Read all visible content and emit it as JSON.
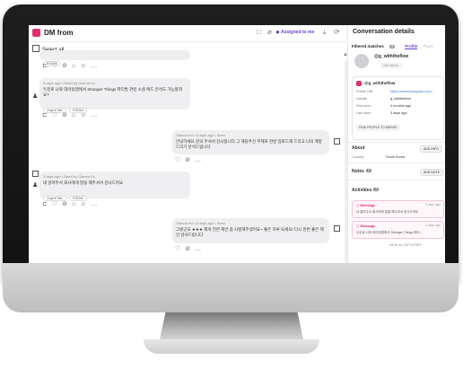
{
  "header": {
    "title": "DM from",
    "assigned_label": "Assigned to me"
  },
  "list": {
    "select_all": "Select all",
    "messages": [
      {
        "meta": "",
        "text": "",
        "tags": [
          "RIS263"
        ]
      },
      {
        "meta": "3 days ago • Read by Gianna Ko",
        "text": "두분로 나와 데이팅앱에서 Stranger Things 파티발 관련 소셜 에드 분석도 가능할까요?",
        "tags": [
          "Urgent Skin",
          "RIS263"
        ]
      },
      {
        "meta": "Gianna Ko • 3 days ago • Seen",
        "text": "안녕하세요 문의 주셔서 감사합니다 그 해당주신 주제로 관련 업로드해 드리고 나의 계정 드리기 분석드립니다",
        "tags": []
      },
      {
        "meta": "3 days ago • Read by Gianna Ko",
        "text": "네 알려주서 회사에게 말을 해주셔서 감사드려요",
        "tags": [
          "Urgent Skin",
          "RIS263"
        ]
      },
      {
        "meta": "Gianna Ko • 3 days ago • Seen",
        "text": "그렇군요 ★★★ 제게 전한 제안 좀 사항해주셨어요~ 좋은 하루 되세요! 다시 한번 좋은 제안 감사드립니다",
        "tags": []
      }
    ]
  },
  "panel": {
    "title": "Conversation details",
    "tabs": {
      "filtered": "Filtered matches",
      "filtered_count": "4",
      "profile": "Profile",
      "posts": "Posts"
    },
    "profile": {
      "name": "@g_withtheflow",
      "add_tags": "Add labels...",
      "card_handle": "@g_withtheflow",
      "rows": [
        {
          "label": "Profile URL",
          "value": "https://www.instagram.com/..."
        },
        {
          "label": "Handle",
          "value": "g_withtheflow"
        },
        {
          "label": "First seen",
          "value": "4 months ago"
        },
        {
          "label": "Last seen",
          "value": "3 days ago"
        }
      ],
      "find_button": "FIND PEOPLE TO MERGE"
    },
    "about": {
      "title": "About",
      "add_button": "ADD INFO",
      "country_label": "Country",
      "country_value": "South Korea"
    },
    "notes": {
      "title": "Notes",
      "count": "0",
      "add_button": "ADD NOTE"
    },
    "activities": {
      "title": "Activities",
      "count": "2",
      "items": [
        {
          "label": "Message",
          "time": "4 days ago",
          "text": "네 알려주서 회사에게 말을 해주셔서 감사드려요"
        },
        {
          "label": "Message",
          "time": "4 days ago",
          "text": "두분로 나와 데이팅앱에서 Stranger Things 파티..."
        }
      ],
      "view_all": "VIEW ALL ACTIVITIES"
    }
  },
  "colors": {
    "accent": "#6a3fd4",
    "instagram": "#e1306c",
    "bubble": "#efeff1"
  }
}
